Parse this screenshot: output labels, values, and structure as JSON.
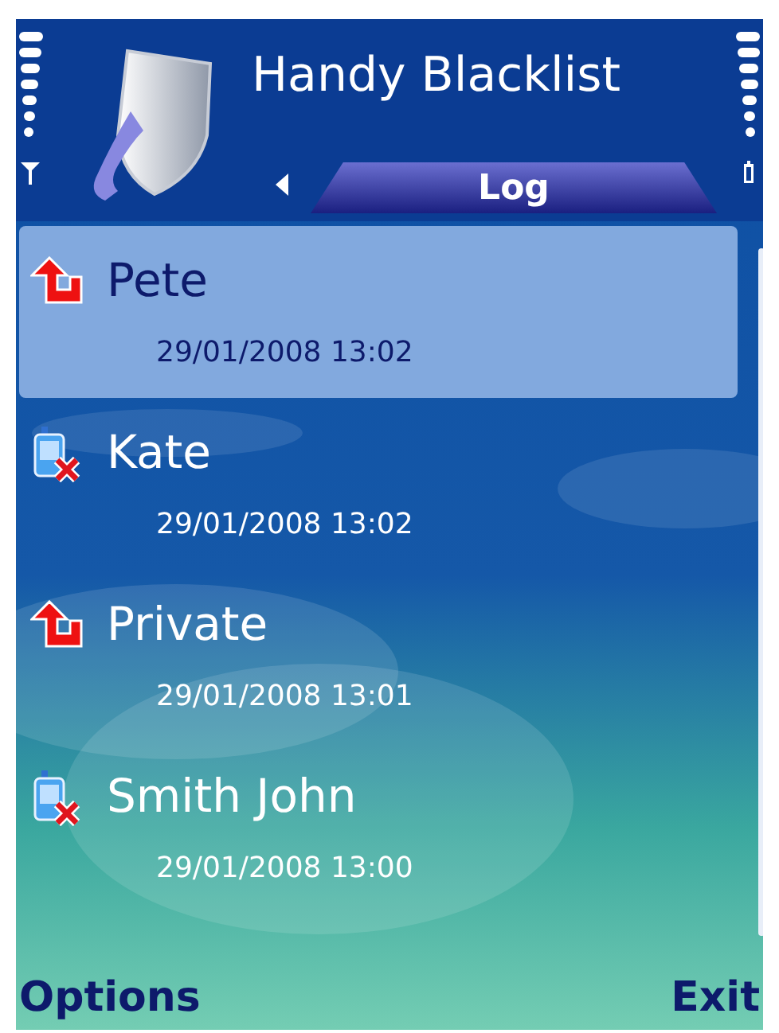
{
  "header": {
    "title": "Handy Blacklist",
    "tab": {
      "label": "Log",
      "selected": true
    }
  },
  "log": [
    {
      "kind": "outgoing",
      "name": "Pete",
      "time": "29/01/2008 13:02",
      "selected": true
    },
    {
      "kind": "blocked",
      "name": "Kate",
      "time": "29/01/2008 13:02",
      "selected": false
    },
    {
      "kind": "outgoing",
      "name": "Private",
      "time": "29/01/2008 13:01",
      "selected": false
    },
    {
      "kind": "blocked",
      "name": "Smith John",
      "time": "29/01/2008 13:00",
      "selected": false
    }
  ],
  "softkeys": {
    "left": "Options",
    "right": "Exit"
  }
}
